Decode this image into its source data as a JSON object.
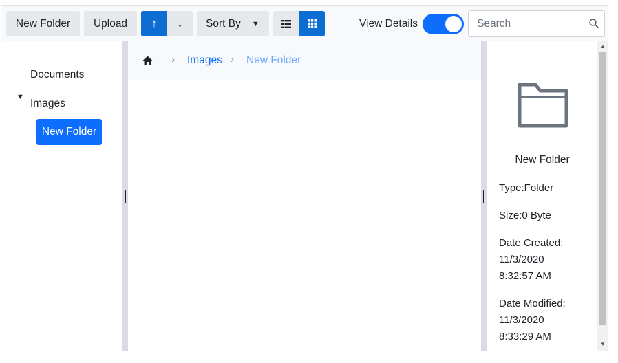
{
  "toolbar": {
    "new_folder": "New Folder",
    "upload": "Upload",
    "sort_asc": "↑",
    "sort_desc": "↓",
    "sort_by": "Sort By",
    "view_details": "View Details",
    "view_details_on": true,
    "search_placeholder": "Search"
  },
  "nav": {
    "items": [
      {
        "label": "Documents"
      },
      {
        "label": "Images",
        "expanded": true
      },
      {
        "label": "New Folder",
        "selected": true
      }
    ]
  },
  "breadcrumb": {
    "items": [
      "Images",
      "New Folder"
    ]
  },
  "details": {
    "name": "New Folder",
    "type": "Type:Folder",
    "size": "Size:0 Byte",
    "created_label": "Date Created:",
    "created_date": "11/3/2020",
    "created_time": "8:32:57 AM",
    "modified_label": "Date Modified:",
    "modified_date": "11/3/2020",
    "modified_time": "8:33:29 AM"
  },
  "icons": {
    "home": "home-icon",
    "search": "search-icon",
    "list_view": "list-view-icon",
    "grid_view": "grid-view-icon",
    "folder": "folder-icon",
    "caret": "caret-down-icon"
  },
  "colors": {
    "accent": "#0d6efd",
    "accent_dark": "#0d6dd2",
    "toolbar_bg": "#f8f9fa",
    "button_bg": "#e6e8eb",
    "splitter": "#d9dde3",
    "folder_icon": "#6c757d"
  }
}
